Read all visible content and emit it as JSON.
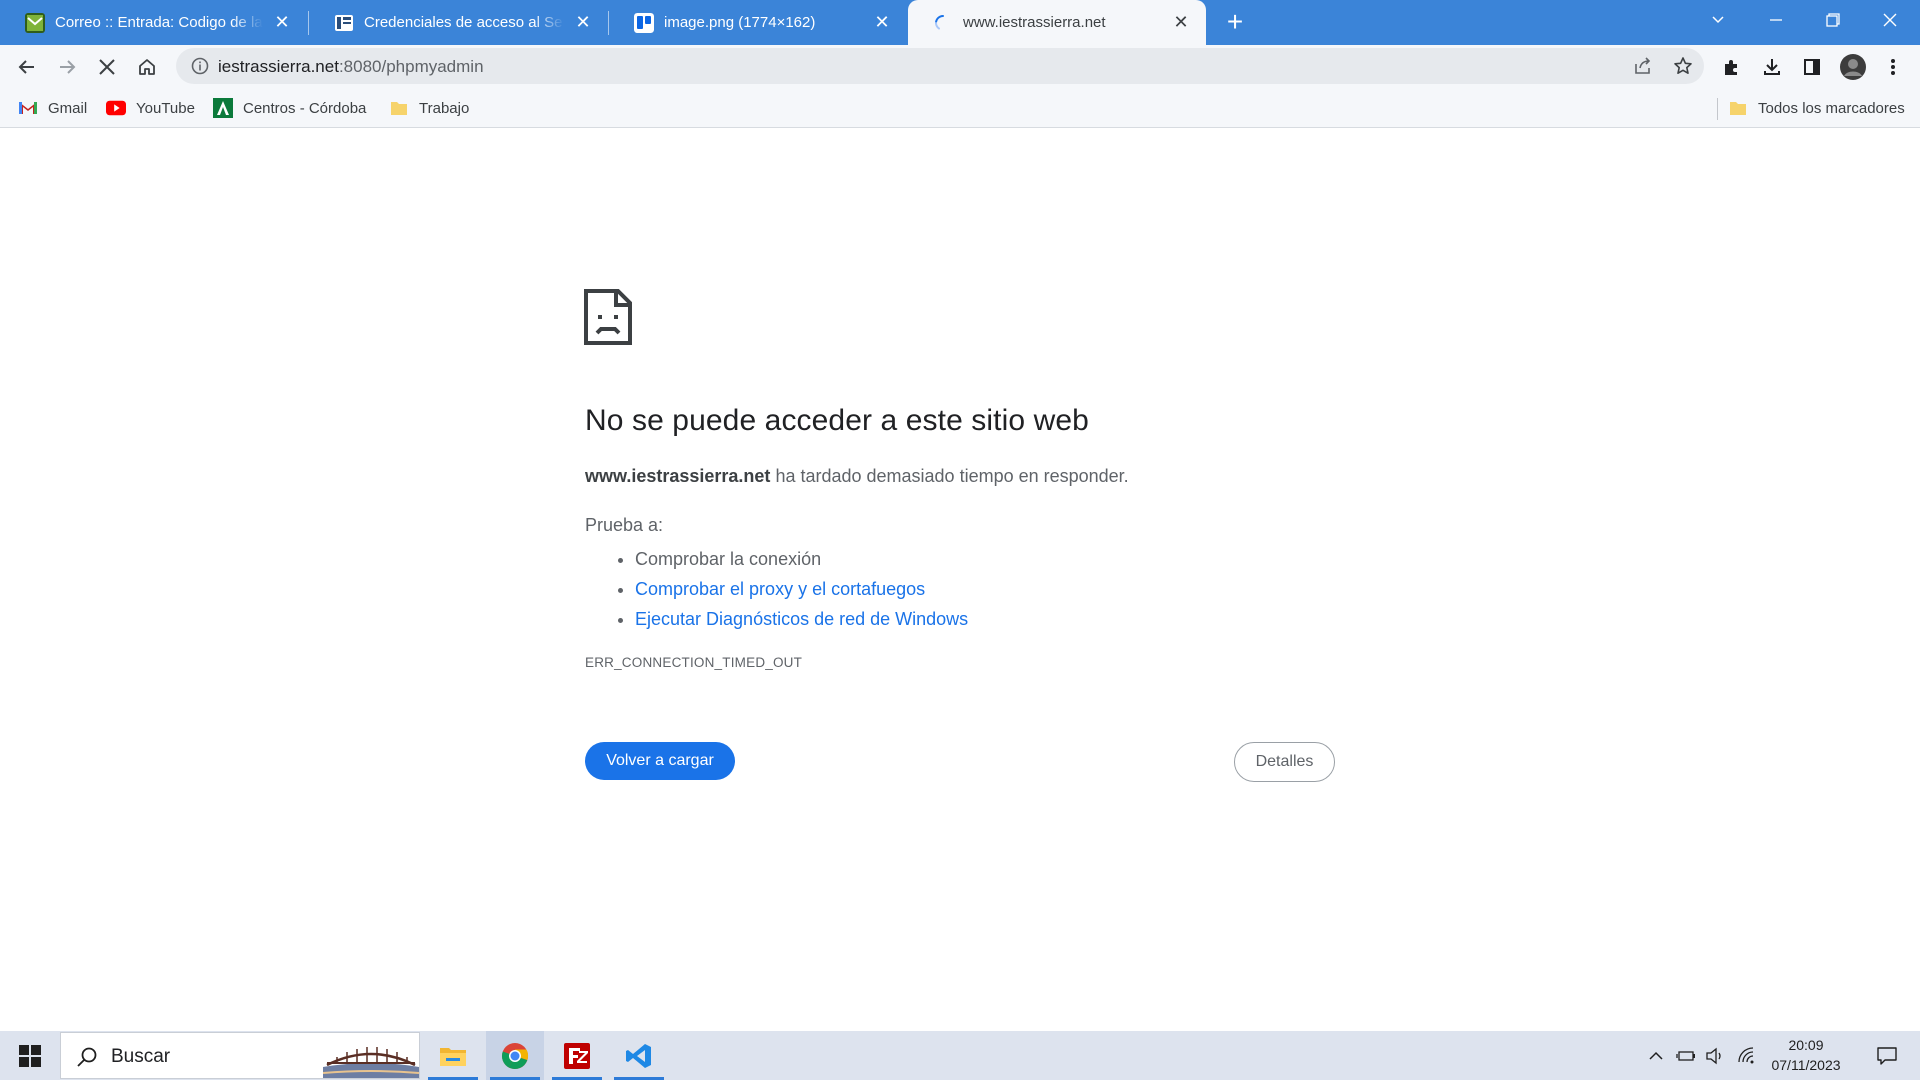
{
  "tabs": [
    {
      "title": "Correo :: Entrada: Codigo de la asignatura",
      "favicon": "roundcube-mail-icon"
    },
    {
      "title": "Credenciales de acceso al Servidor",
      "favicon": "moodle-document-icon"
    },
    {
      "title": "image.png (1774×162)",
      "favicon": "trello-icon"
    },
    {
      "title": "www.iestrassierra.net",
      "favicon": "loading-spinner-icon",
      "active": true
    }
  ],
  "address_bar": {
    "url_host": "iestrassierra.net",
    "url_rest": ":8080/phpmyadmin"
  },
  "bookmarks": [
    {
      "label": "Gmail",
      "icon": "gmail-icon"
    },
    {
      "label": "YouTube",
      "icon": "youtube-icon"
    },
    {
      "label": "Centros - Córdoba",
      "icon": "junta-andalucia-icon"
    },
    {
      "label": "Trabajo",
      "icon": "folder-icon"
    }
  ],
  "all_bookmarks_label": "Todos los marcadores",
  "error_page": {
    "title": "No se puede acceder a este sitio web",
    "host": "www.iestrassierra.net",
    "description_rest": " ha tardado demasiado tiempo en responder.",
    "try_label": "Prueba a:",
    "suggestions": [
      {
        "text": "Comprobar la conexión",
        "link": false
      },
      {
        "text": "Comprobar el proxy y el cortafuegos",
        "link": true
      },
      {
        "text": "Ejecutar Diagnósticos de red de Windows",
        "link": true
      }
    ],
    "error_code": "ERR_CONNECTION_TIMED_OUT",
    "reload_label": "Volver a cargar",
    "details_label": "Detalles"
  },
  "taskbar": {
    "search_placeholder": "Buscar",
    "apps": [
      "file-explorer-icon",
      "chrome-icon",
      "filezilla-icon",
      "vscode-icon"
    ],
    "time": "20:09",
    "date": "07/11/2023"
  },
  "colors": {
    "tabstrip": "#3b84d8",
    "link": "#1a73e8",
    "primary_button": "#1a73e8",
    "taskbar": "#dde3ee"
  }
}
